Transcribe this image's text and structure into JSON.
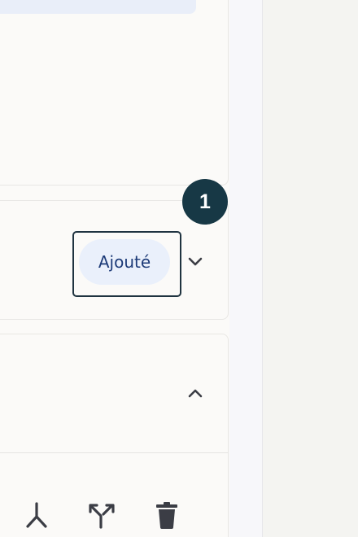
{
  "status_badge": {
    "label": "Ajouté"
  },
  "tutorial_step": {
    "number": "1"
  },
  "colors": {
    "badge_bg": "#eaf0fb",
    "badge_text": "#1d3b78",
    "step_circle": "#173845",
    "focus_ring": "#1f3340",
    "icon": "#3b3d45"
  },
  "icons": {
    "expand": "chevron-down-icon",
    "collapse": "chevron-up-icon",
    "merge": "merge-icon",
    "split": "split-icon",
    "delete": "trash-icon"
  }
}
